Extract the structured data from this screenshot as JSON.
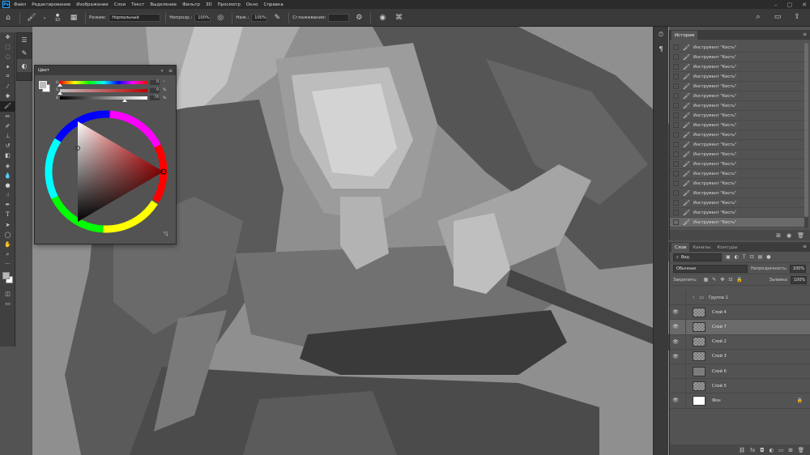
{
  "menu": {
    "logo": "Ps",
    "items": [
      "Файл",
      "Редактирование",
      "Изображение",
      "Слои",
      "Текст",
      "Выделение",
      "Фильтр",
      "3D",
      "Просмотр",
      "Окно",
      "Справка"
    ]
  },
  "options": {
    "brush_size": "10",
    "mode_label": "Режим:",
    "mode_value": "Нормальный",
    "opacity_label": "Непрозр.:",
    "opacity_value": "100%",
    "flow_label": "Наж.:",
    "flow_value": "100%",
    "smoothing_label": "Сглаживание:"
  },
  "color_panel": {
    "tab": "Цвет",
    "sliders": [
      {
        "letter": "H",
        "value": "0",
        "unit": "°"
      },
      {
        "letter": "S",
        "value": "0",
        "unit": "%"
      },
      {
        "letter": "B",
        "value": "74",
        "unit": "%"
      }
    ],
    "foreground": "#bdbdbd",
    "background": "#ffffff",
    "hue": 0,
    "saturation": 0,
    "brightness": 74
  },
  "dock": {
    "history_icon": "history-icon",
    "paragraph_icon": "paragraph-icon"
  },
  "history": {
    "tab": "История",
    "steps": [
      "Инструмент \"Кисть\"",
      "Инструмент \"Кисть\"",
      "Инструмент \"Кисть\"",
      "Инструмент \"Кисть\"",
      "Инструмент \"Кисть\"",
      "Инструмент \"Кисть\"",
      "Инструмент \"Кисть\"",
      "Инструмент \"Кисть\"",
      "Инструмент \"Кисть\"",
      "Инструмент \"Кисть\"",
      "Инструмент \"Кисть\"",
      "Инструмент \"Кисть\"",
      "Инструмент \"Кисть\"",
      "Инструмент \"Кисть\"",
      "Инструмент \"Кисть\"",
      "Инструмент \"Кисть\"",
      "Инструмент \"Кисть\"",
      "Инструмент \"Кисть\"",
      "Инструмент \"Кисть\""
    ]
  },
  "layers_panel": {
    "tabs": [
      "Слои",
      "Каналы",
      "Контуры"
    ],
    "filter_kind": "Вид",
    "blend_mode": "Обычные",
    "opacity_label": "Непрозрачность:",
    "opacity_value": "100%",
    "lock_label": "Закрепить:",
    "fill_label": "Заливка:",
    "fill_value": "100%",
    "layers": [
      {
        "name": "Группа 1",
        "kind": "group",
        "visible": false
      },
      {
        "name": "Слой 4",
        "kind": "transparent",
        "visible": true
      },
      {
        "name": "Слой 7",
        "kind": "transparent",
        "visible": true,
        "selected": true
      },
      {
        "name": "Слой 2",
        "kind": "transparent",
        "visible": true
      },
      {
        "name": "Слой 3",
        "kind": "transparent",
        "visible": true
      },
      {
        "name": "Слой 6",
        "kind": "gray",
        "visible": false
      },
      {
        "name": "Слой 5",
        "kind": "transparent",
        "visible": false
      },
      {
        "name": "Фон",
        "kind": "white",
        "visible": true,
        "locked": true
      }
    ]
  }
}
